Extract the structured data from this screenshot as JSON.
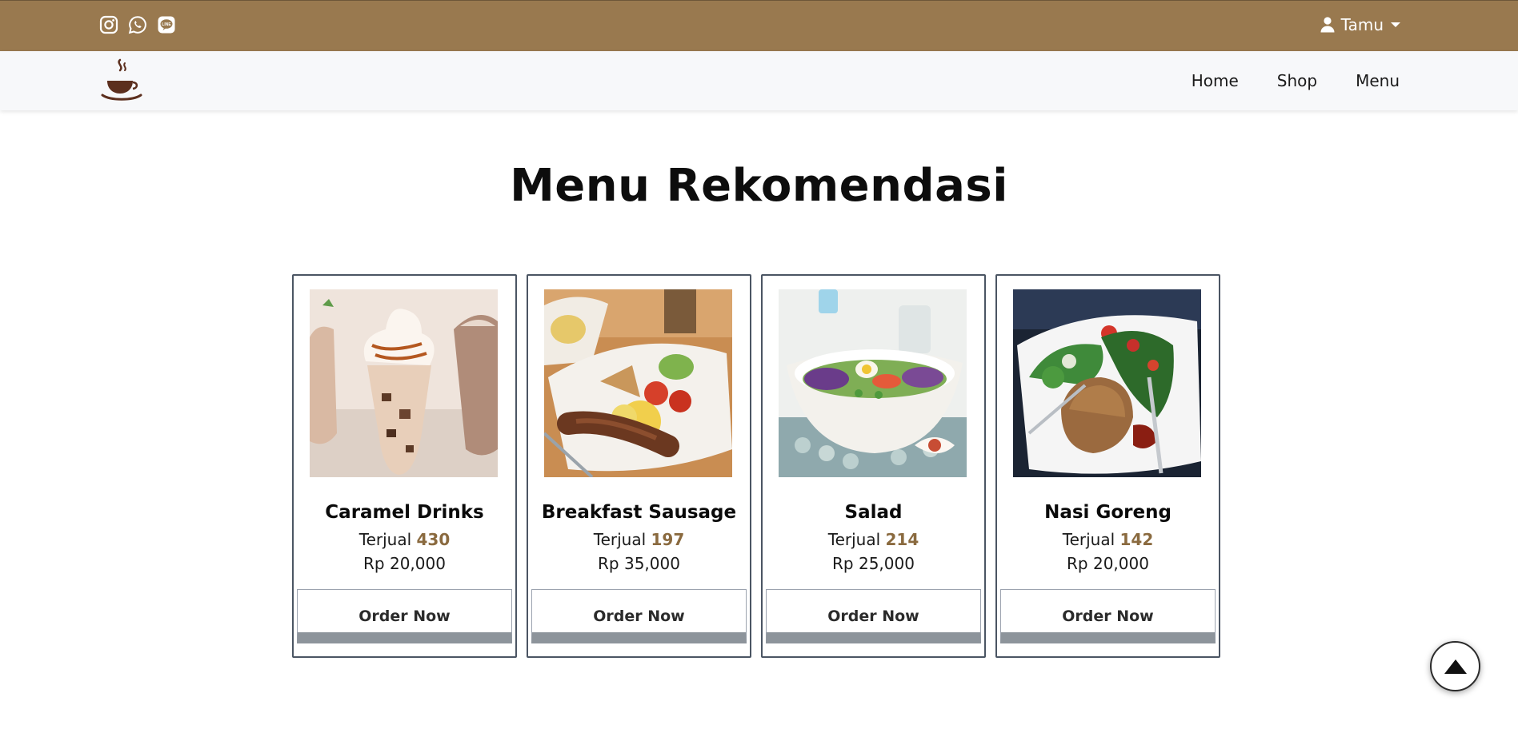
{
  "header": {
    "social": [
      {
        "icon": "instagram-icon"
      },
      {
        "icon": "whatsapp-icon"
      },
      {
        "icon": "line-icon"
      }
    ],
    "user_label": "Tamu"
  },
  "nav": {
    "items": [
      "Home",
      "Shop",
      "Menu"
    ]
  },
  "page": {
    "title": "Menu Rekomendasi"
  },
  "products": [
    {
      "name": "Caramel Drinks",
      "sold_label": "Terjual",
      "sold_count": "430",
      "price": "Rp 20,000",
      "button": "Order Now"
    },
    {
      "name": "Breakfast Sausage",
      "sold_label": "Terjual",
      "sold_count": "197",
      "price": "Rp 35,000",
      "button": "Order Now"
    },
    {
      "name": "Salad",
      "sold_label": "Terjual",
      "sold_count": "214",
      "price": "Rp 25,000",
      "button": "Order Now"
    },
    {
      "name": "Nasi Goreng",
      "sold_label": "Terjual",
      "sold_count": "142",
      "price": "Rp 20,000",
      "button": "Order Now"
    }
  ],
  "colors": {
    "topbar": "#99794f",
    "accent": "#8a6a3f",
    "button_shadow": "#8d949b"
  }
}
